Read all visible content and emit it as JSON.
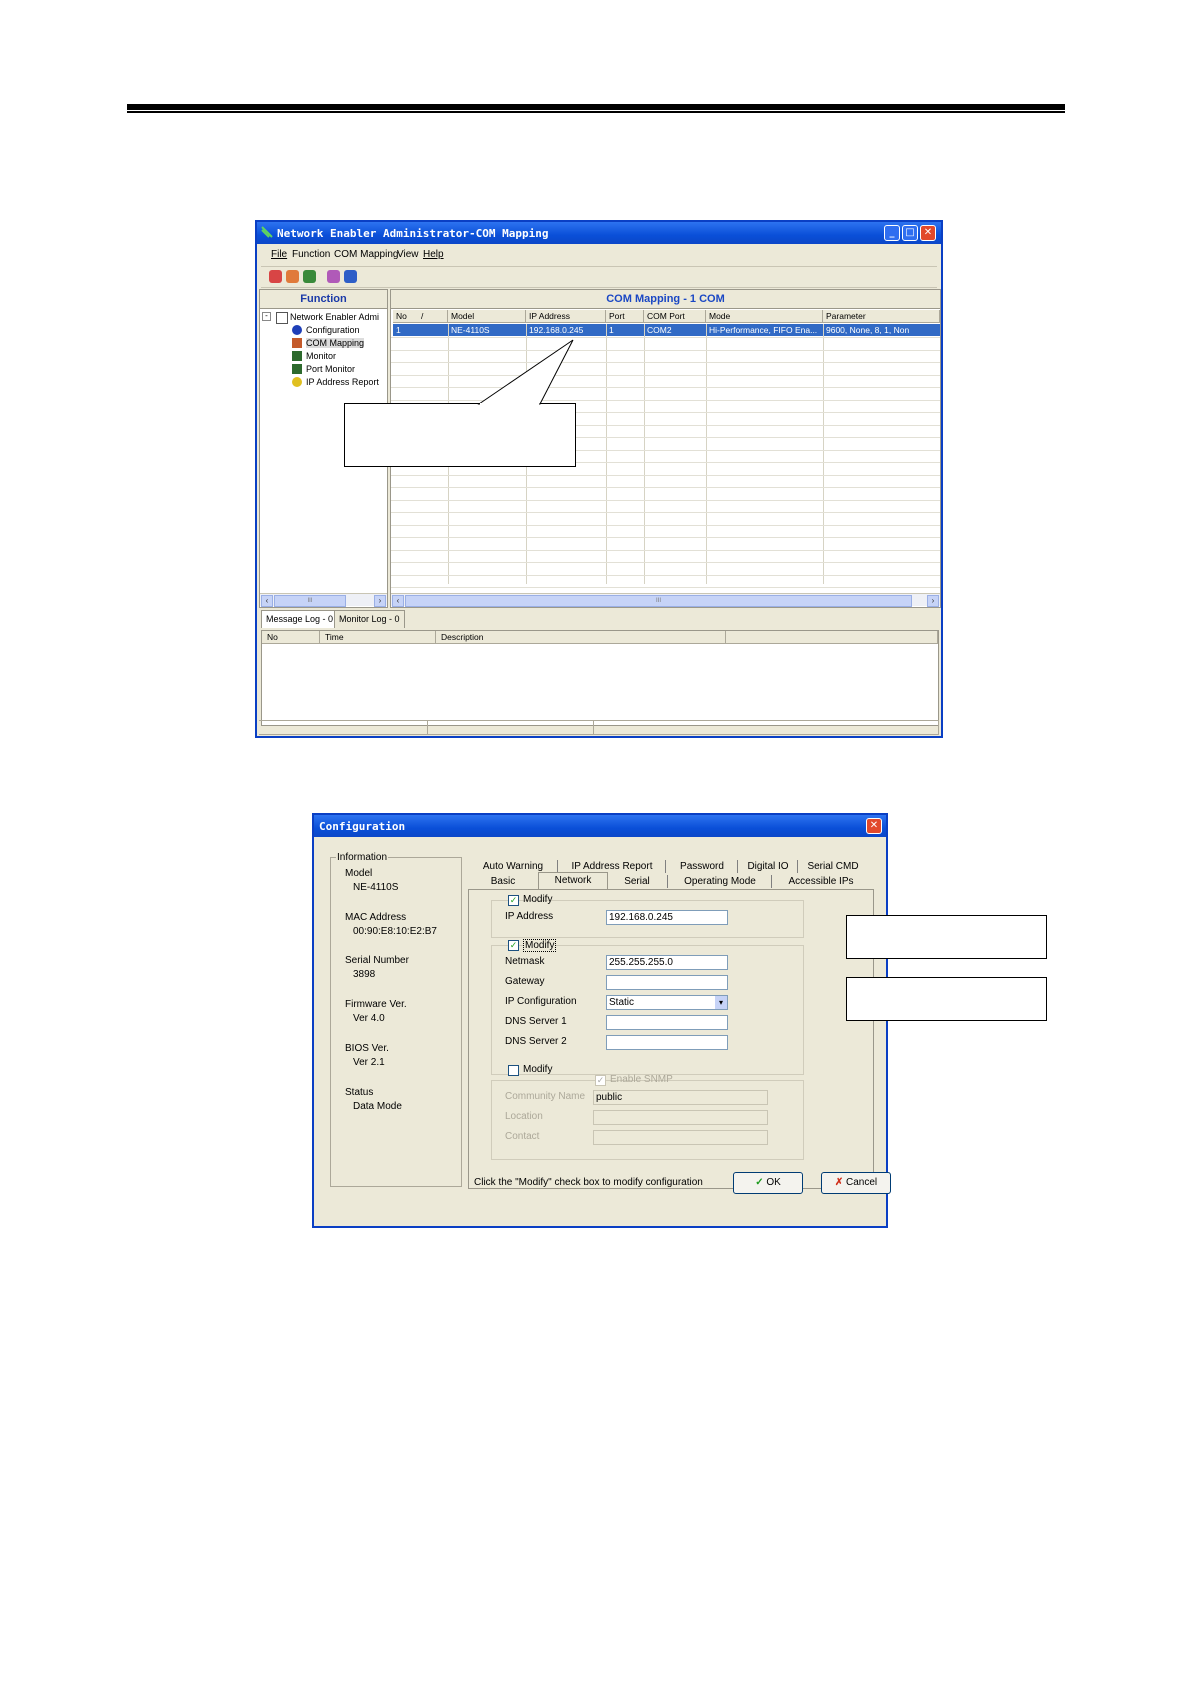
{
  "main_window": {
    "title": "Network Enabler Administrator-COM Mapping",
    "menu": [
      "File",
      "Function",
      "COM Mapping",
      "View",
      "Help"
    ],
    "left_panel_title": "Function",
    "tree": [
      "Network Enabler Admi",
      "Configuration",
      "COM Mapping",
      "Monitor",
      "Port Monitor",
      "IP Address Report"
    ],
    "right_panel_title": "COM Mapping - 1 COM",
    "table_headers": [
      "No",
      "Model",
      "IP Address",
      "Port",
      "COM Port",
      "Mode",
      "Parameter"
    ],
    "sort_indicator": "/",
    "table_row": [
      "1",
      "NE-4110S",
      "192.168.0.245",
      "1",
      "COM2",
      "Hi-Performance, FIFO Ena...",
      "9600, None, 8, 1, Non"
    ],
    "log_tabs": [
      "Message Log - 0",
      "Monitor Log - 0"
    ],
    "log_headers": [
      "No",
      "Time",
      "Description"
    ],
    "scroll_thumb": "III"
  },
  "config_window": {
    "title": "Configuration",
    "info": {
      "heading": "Information",
      "model_label": "Model",
      "model": "NE-4110S",
      "mac_label": "MAC Address",
      "mac": "00:90:E8:10:E2:B7",
      "serial_label": "Serial Number",
      "serial": "3898",
      "firmware_label": "Firmware Ver.",
      "firmware": "Ver 4.0",
      "bios_label": "BIOS Ver.",
      "bios": "Ver 2.1",
      "status_label": "Status",
      "status": "Data Mode"
    },
    "tabs_row1": [
      "Auto Warning",
      "IP Address Report",
      "Password",
      "Digital IO",
      "Serial CMD"
    ],
    "tabs_row2": [
      "Basic",
      "Network",
      "Serial",
      "Operating Mode",
      "Accessible IPs"
    ],
    "modify_label": "Modify",
    "ip_label": "IP Address",
    "ip_value": "192.168.0.245",
    "netmask_label": "Netmask",
    "netmask_value": "255.255.255.0",
    "gateway_label": "Gateway",
    "gateway_value": "",
    "ipconfig_label": "IP Configuration",
    "ipconfig_value": "Static",
    "dns1_label": "DNS Server 1",
    "dns2_label": "DNS Server 2",
    "snmp_label": "Enable SNMP",
    "community_label": "Community Name",
    "community_value": "public",
    "location_label": "Location",
    "contact_label": "Contact",
    "hint": "Click the \"Modify\" check box to modify configuration",
    "ok": "OK",
    "cancel": "Cancel"
  }
}
